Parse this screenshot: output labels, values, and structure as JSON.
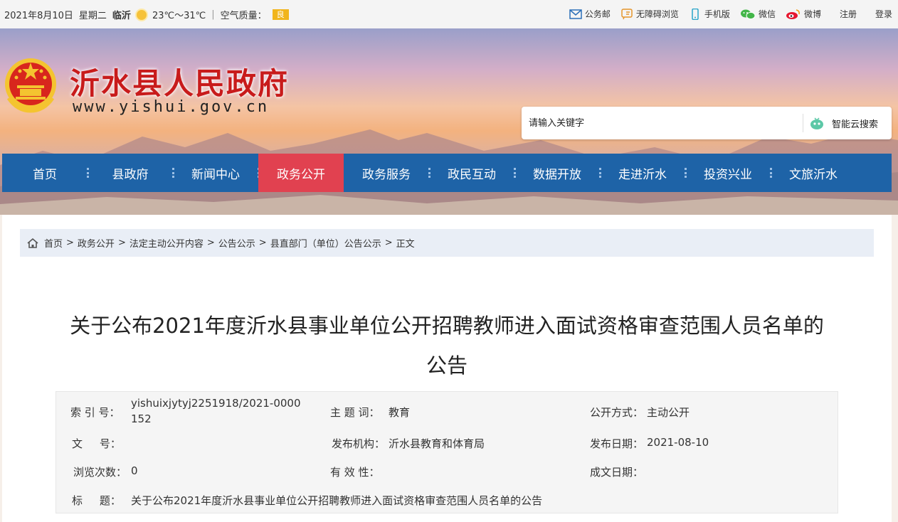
{
  "topbar": {
    "date": "2021年8月10日",
    "weekday": "星期二",
    "city": "临沂",
    "weather_icon": "sun-icon",
    "temperature": "23℃～31℃",
    "sep": "|",
    "air_quality_label": "空气质量：",
    "air_quality_value": "良",
    "links": [
      {
        "icon": "mail-icon",
        "label": "公务邮"
      },
      {
        "icon": "accessibility-icon",
        "label": "无障碍浏览"
      },
      {
        "icon": "mobile-icon",
        "label": "手机版"
      },
      {
        "icon": "wechat-icon",
        "label": "微信"
      },
      {
        "icon": "weibo-icon",
        "label": "微博"
      }
    ],
    "register": "注册",
    "login": "登录"
  },
  "header": {
    "site_name": "沂水县人民政府",
    "site_url": "www.yishui.gov.cn",
    "search_placeholder": "请输入关键字",
    "search_button": "智能云搜索"
  },
  "nav": {
    "items": [
      {
        "label": "首页"
      },
      {
        "label": "县政府"
      },
      {
        "label": "新闻中心"
      },
      {
        "label": "政务公开",
        "active": true
      },
      {
        "label": "政务服务"
      },
      {
        "label": "政民互动"
      },
      {
        "label": "数据开放"
      },
      {
        "label": "走进沂水"
      },
      {
        "label": "投资兴业"
      },
      {
        "label": "文旅沂水"
      }
    ],
    "active_color": "#e14150",
    "bar_color": "#1e63a7"
  },
  "breadcrumb": [
    "首页",
    "政务公开",
    "法定主动公开内容",
    "公告公示",
    "县直部门（单位）公告公示",
    "正文"
  ],
  "breadcrumb_sep": ">",
  "article": {
    "title_line1": "关于公布2021年度沂水县事业单位公开招聘教师进入面试资格审查范围人员名单的",
    "title_line2": "公告"
  },
  "meta": {
    "index_label": "索 引 号：",
    "index_value": "yishuixjytyj2251918/2021-0000152",
    "topic_label": "主 题 词：",
    "topic_value": "教育",
    "open_mode_label": "公开方式：",
    "open_mode_value": "主动公开",
    "doc_no_label": "文     号：",
    "doc_no_value": "",
    "publisher_label": "发布机构：",
    "publisher_value": "沂水县教育和体育局",
    "publish_date_label": "发布日期：",
    "publish_date_value": "2021-08-10",
    "views_label": "浏览次数：",
    "views_value": "0",
    "validity_label": "有 效 性：",
    "validity_value": "",
    "create_date_label": "成文日期：",
    "create_date_value": "",
    "subject_label": "标     题：",
    "subject_value": "关于公布2021年度沂水县事业单位公开招聘教师进入面试资格审查范围人员名单的公告"
  }
}
